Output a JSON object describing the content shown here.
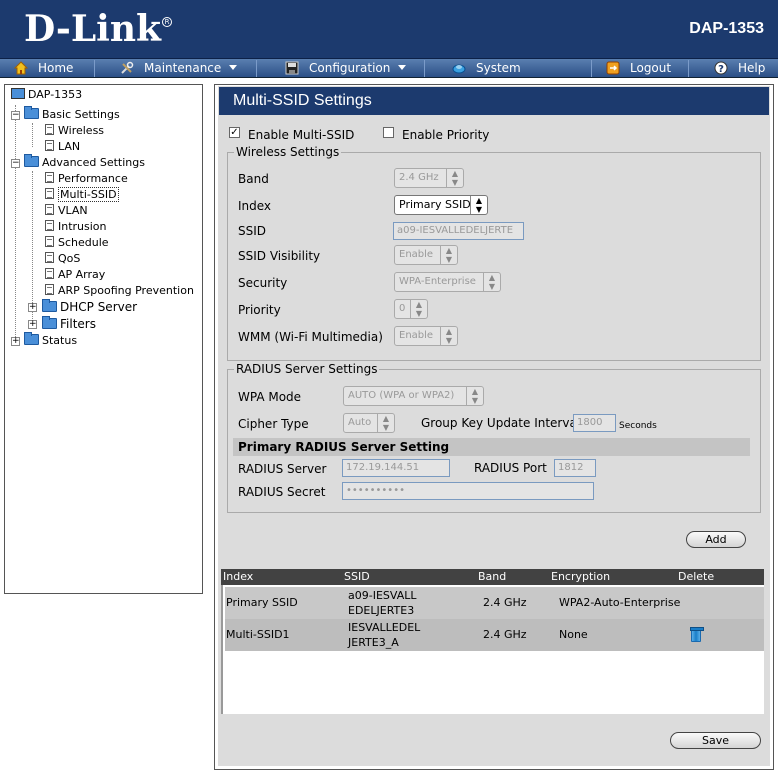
{
  "header": {
    "brand": "D-Link",
    "model": "DAP-1353"
  },
  "nav": {
    "home": "Home",
    "maintenance": "Maintenance",
    "configuration": "Configuration",
    "system": "System",
    "logout": "Logout",
    "help": "Help"
  },
  "tree": {
    "root": "DAP-1353",
    "basic": "Basic Settings",
    "wireless": "Wireless",
    "lan": "LAN",
    "advanced": "Advanced Settings",
    "performance": "Performance",
    "multissid": "Multi-SSID",
    "vlan": "VLAN",
    "intrusion": "Intrusion",
    "schedule": "Schedule",
    "qos": "QoS",
    "aparray": "AP Array",
    "arp": "ARP Spoofing Prevention",
    "dhcp": "DHCP Server",
    "filters": "Filters",
    "status": "Status"
  },
  "page": {
    "title": "Multi-SSID Settings",
    "enable_multi_ssid": "Enable Multi-SSID",
    "enable_multi_ssid_checked": true,
    "enable_priority": "Enable Priority",
    "enable_priority_checked": false
  },
  "wireless": {
    "legend": "Wireless Settings",
    "band_label": "Band",
    "band_value": "2.4 GHz",
    "index_label": "Index",
    "index_value": "Primary SSID",
    "ssid_label": "SSID",
    "ssid_value": "a09-IESVALLEDELJERTE",
    "visibility_label": "SSID Visibility",
    "visibility_value": "Enable",
    "security_label": "Security",
    "security_value": "WPA-Enterprise",
    "priority_label": "Priority",
    "priority_value": "0",
    "wmm_label": "WMM (Wi-Fi Multimedia)",
    "wmm_value": "Enable"
  },
  "radius": {
    "legend": "RADIUS Server Settings",
    "wpa_mode_label": "WPA Mode",
    "wpa_mode_value": "AUTO (WPA or WPA2)",
    "cipher_label": "Cipher Type",
    "cipher_value": "Auto",
    "gkui_label": "Group Key Update Interval",
    "gkui_value": "1800",
    "gkui_unit": "Seconds",
    "primary_header": "Primary RADIUS Server Setting",
    "server_label": "RADIUS Server",
    "server_value": "172.19.144.51",
    "port_label": "RADIUS Port",
    "port_value": "1812",
    "secret_label": "RADIUS Secret",
    "secret_value": "••••••••••"
  },
  "buttons": {
    "add": "Add",
    "save": "Save"
  },
  "table": {
    "headers": [
      "Index",
      "SSID",
      "Band",
      "Encryption",
      "Delete"
    ],
    "rows": [
      {
        "index": "Primary SSID",
        "ssid_line1": "a09-IESVALL",
        "ssid_line2": "EDELJERTE3",
        "band": "2.4 GHz",
        "encryption": "WPA2-Auto-Enterprise"
      },
      {
        "index": "Multi-SSID1",
        "ssid_line1": "IESVALLEDEL",
        "ssid_line2": "JERTE3_A",
        "band": "2.4 GHz",
        "encryption": "None"
      }
    ]
  }
}
